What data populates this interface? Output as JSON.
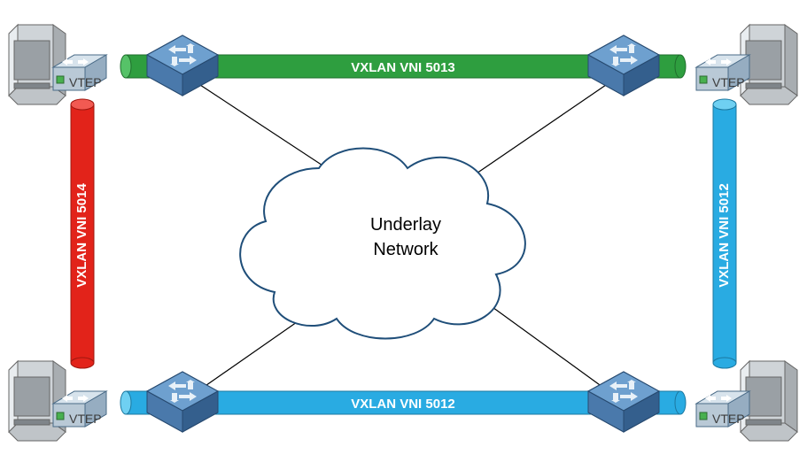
{
  "cloud": {
    "line1": "Underlay",
    "line2": "Network"
  },
  "tunnels": {
    "top": {
      "label": "VXLAN VNI 5013",
      "color": "#2e9e3f",
      "stroke": "#1f6e2c"
    },
    "bottom": {
      "label": "VXLAN VNI 5012",
      "color": "#29abe2",
      "stroke": "#1c78a0"
    },
    "left": {
      "label": "VXLAN VNI 5014",
      "color": "#e2231a",
      "stroke": "#9f170f"
    },
    "right": {
      "label": "VXLAN VNI 5012",
      "color": "#29abe2",
      "stroke": "#1c78a0"
    }
  },
  "vtep": {
    "label": "VTEP"
  }
}
